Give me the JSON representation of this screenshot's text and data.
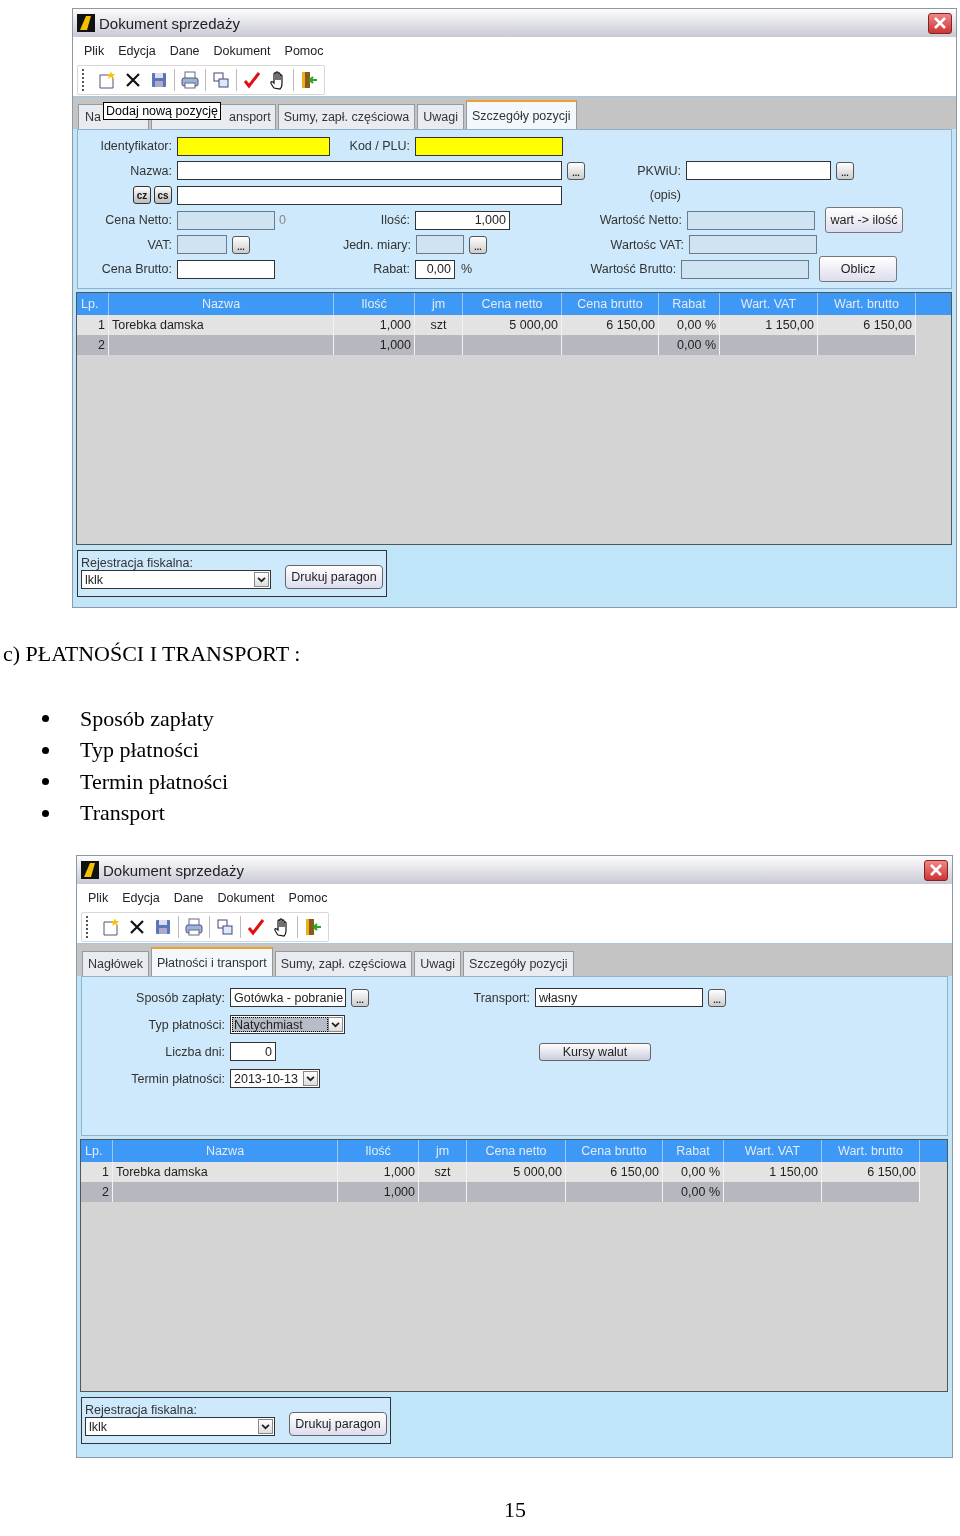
{
  "first_window": {
    "title": "Dokument sprzedaży",
    "menu": [
      "Plik",
      "Edycja",
      "Dane",
      "Dokument",
      "Pomoc"
    ],
    "tooltip": "Dodaj nową pozycję",
    "tabs": [
      {
        "label": "Na",
        "selected": false
      },
      {
        "label": "ansport",
        "selected": false
      },
      {
        "label": "Sumy, zapł. częściowa",
        "selected": false
      },
      {
        "label": "Uwagi",
        "selected": false
      },
      {
        "label": "Szczegóły pozycji",
        "selected": true
      }
    ],
    "panel": {
      "kind": "item_details",
      "identifier": {
        "label": "Identyfikator:",
        "highlighted": true,
        "disabled": false
      },
      "plu_code": {
        "label": "Kod / PLU:",
        "highlighted": true,
        "disabled": false
      },
      "name": {
        "label": "Nazwa:",
        "button": "...",
        "highlighted": false,
        "disabled": false
      },
      "pkwiu": {
        "label": "PKWiU:",
        "note": "(opis)",
        "button": "...",
        "highlighted": false,
        "disabled": false
      },
      "lang_buttons": [
        "cz",
        "cs"
      ],
      "name_2": {
        "highlighted": false,
        "disabled": false
      },
      "net_price": {
        "label": "Cena Netto:",
        "suffix": "0",
        "highlighted": false,
        "disabled": true
      },
      "quantity": {
        "label": "Ilość:",
        "value": "1,000",
        "highlighted": false,
        "disabled": false
      },
      "net_value": {
        "label": "Wartość Netto:",
        "highlighted": false,
        "disabled": true
      },
      "vat": {
        "label": "VAT:",
        "button": "...",
        "highlighted": false,
        "disabled": true
      },
      "unit": {
        "label": "Jedn. miary:",
        "button": "...",
        "highlighted": false,
        "disabled": true
      },
      "vat_value": {
        "label": "Wartośc VAT:",
        "highlighted": false,
        "disabled": true
      },
      "gross_price": {
        "label": "Cena Brutto:",
        "highlighted": false,
        "disabled": false
      },
      "discount": {
        "label": "Rabat:",
        "value": "0,00",
        "suffix": "%",
        "highlighted": false,
        "disabled": false
      },
      "gross_value": {
        "label": "Wartość Brutto:",
        "highlighted": false,
        "disabled": true
      },
      "buttons": [
        "wart -> ilość",
        "Oblicz"
      ]
    },
    "table": {
      "columns": [
        "Lp.",
        "Nazwa",
        "Ilość",
        "jm",
        "Cena netto",
        "Cena brutto",
        "Rabat",
        "Wart. VAT",
        "Wart. brutto"
      ],
      "rows": [
        {
          "cells": [
            "1",
            "Torebka damska",
            "1,000",
            "szt",
            "5 000,00",
            "6 150,00",
            "0,00 %",
            "1 150,00",
            "6 150,00"
          ],
          "selected": false
        },
        {
          "cells": [
            "2",
            null,
            "1,000",
            null,
            null,
            null,
            "0,00 %",
            null,
            null
          ],
          "selected": true
        }
      ]
    },
    "fiscal": {
      "label": "Rejestracja fiskalna:",
      "value": "lklk",
      "button": "Drukuj paragon"
    }
  },
  "heading": "c) PŁATNOŚCI I TRANSPORT :",
  "bullets": [
    "Sposób zapłaty",
    "Typ płatności",
    "Termin płatności",
    "Transport"
  ],
  "second_window": {
    "title": "Dokument sprzedaży",
    "menu": [
      "Plik",
      "Edycja",
      "Dane",
      "Dokument",
      "Pomoc"
    ],
    "tabs": [
      {
        "label": "Nagłówek",
        "selected": false
      },
      {
        "label": "Płatności i transport",
        "selected": true
      },
      {
        "label": "Sumy, zapł. częściowa",
        "selected": false
      },
      {
        "label": "Uwagi",
        "selected": false
      },
      {
        "label": "Szczegóły pozycji",
        "selected": false
      }
    ],
    "panel": {
      "kind": "payment",
      "payment_method": {
        "label": "Sposób zapłaty:",
        "value": "Gotówka - pobranie",
        "button": "..."
      },
      "payment_type": {
        "label": "Typ płatności:",
        "value": "Natychmiast",
        "focused": true
      },
      "days": {
        "label": "Liczba dni:",
        "value": "0"
      },
      "due_date": {
        "label": "Termin płatności:",
        "value": "2013-10-13",
        "focused": false
      },
      "transport": {
        "label": "Transport:",
        "value": "własny",
        "button": "..."
      },
      "currency_button": "Kursy walut"
    },
    "table": {
      "columns": [
        "Lp.",
        "Nazwa",
        "Ilość",
        "jm",
        "Cena netto",
        "Cena brutto",
        "Rabat",
        "Wart. VAT",
        "Wart. brutto"
      ],
      "rows": [
        {
          "cells": [
            "1",
            "Torebka damska",
            "1,000",
            "szt",
            "5 000,00",
            "6 150,00",
            "0,00 %",
            "1 150,00",
            "6 150,00"
          ],
          "selected": false
        },
        {
          "cells": [
            "2",
            null,
            "1,000",
            null,
            null,
            null,
            "0,00 %",
            null,
            null
          ],
          "selected": true
        }
      ]
    },
    "fiscal": {
      "label": "Rejestracja fiskalna:",
      "value": "lklk",
      "button": "Drukuj paragon"
    }
  },
  "page_number": "15"
}
